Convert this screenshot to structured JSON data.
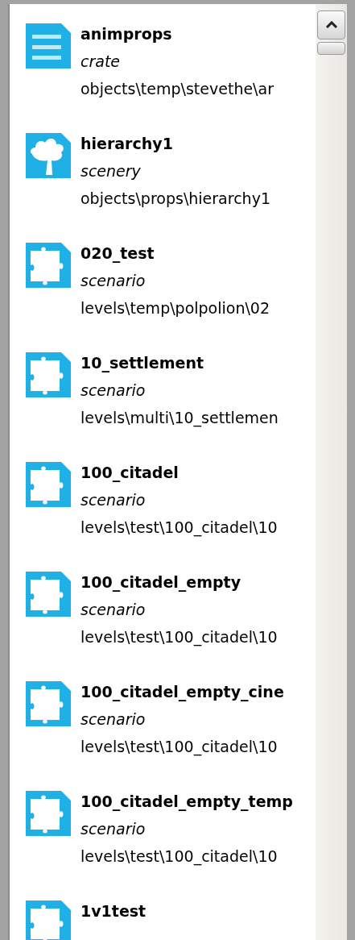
{
  "items": [
    {
      "name": "animprops",
      "type": "crate",
      "path": "objects\\temp\\stevethe\\ar",
      "kind": "document"
    },
    {
      "name": "hierarchy1",
      "type": "scenery",
      "path": "objects\\props\\hierarchy1",
      "kind": "tree"
    },
    {
      "name": "020_test",
      "type": "scenario",
      "path": "levels\\temp\\polpolion\\02",
      "kind": "puzzle"
    },
    {
      "name": "10_settlement",
      "type": "scenario",
      "path": "levels\\multi\\10_settlemen",
      "kind": "puzzle"
    },
    {
      "name": "100_citadel",
      "type": "scenario",
      "path": "levels\\test\\100_citadel\\10",
      "kind": "puzzle"
    },
    {
      "name": "100_citadel_empty",
      "type": "scenario",
      "path": "levels\\test\\100_citadel\\10",
      "kind": "puzzle"
    },
    {
      "name": "100_citadel_empty_cine",
      "type": "scenario",
      "path": "levels\\test\\100_citadel\\10",
      "kind": "puzzle"
    },
    {
      "name": "100_citadel_empty_temp",
      "type": "scenario",
      "path": "levels\\test\\100_citadel\\10",
      "kind": "puzzle"
    },
    {
      "name": "1v1test",
      "kind": "puzzle"
    }
  ]
}
